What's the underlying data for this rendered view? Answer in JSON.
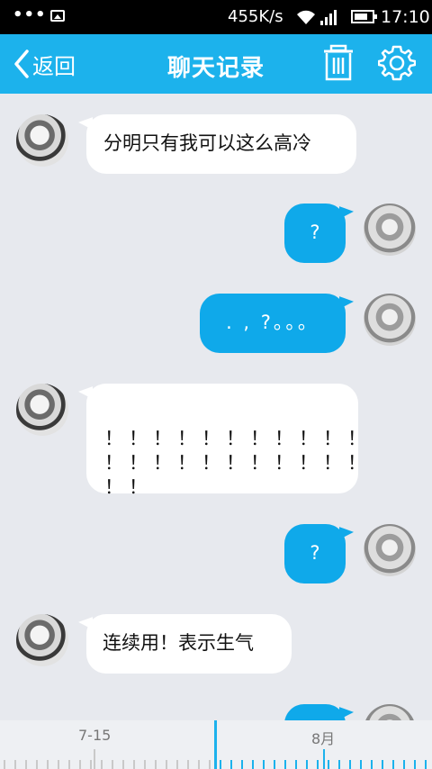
{
  "status_bar": {
    "dots": "•••",
    "net_speed": "455K/s",
    "time": "17:10"
  },
  "header": {
    "back_label": "返回",
    "title": "聊天记录"
  },
  "messages": [
    {
      "side": "in",
      "text": "分明只有我可以这么高冷"
    },
    {
      "side": "out",
      "text": "?"
    },
    {
      "side": "out",
      "text": ". , ?。。。"
    },
    {
      "side": "in",
      "text": "！！！！！！！！！！！\n！！！！！！！！！！！\n！！"
    },
    {
      "side": "out",
      "text": "?"
    },
    {
      "side": "in",
      "text": "连续用！表示生气"
    }
  ],
  "timeline": {
    "labels": [
      "7-15",
      "8月"
    ]
  },
  "colors": {
    "header_bg": "#1cb2ec",
    "outgoing_bubble": "#0fa9ea",
    "incoming_bubble": "#ffffff",
    "background": "#e7e9ee"
  }
}
